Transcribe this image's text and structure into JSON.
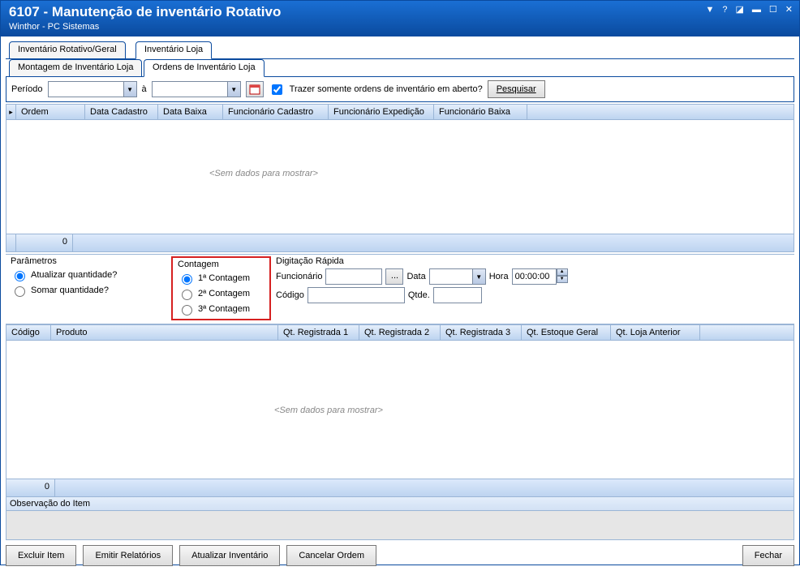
{
  "titlebar": {
    "title": "6107 - Manutenção de inventário Rotativo",
    "subtitle": "Winthor - PC Sistemas"
  },
  "tabs_main": {
    "tab0": "Inventário Rotativo/Geral",
    "tab1": "Inventário Loja"
  },
  "tabs_sub": {
    "tab0": "Montagem de Inventário Loja",
    "tab1": "Ordens de Inventário Loja"
  },
  "period": {
    "label": "Período",
    "to": "à",
    "chk_label": "Trazer somente ordens de inventário em aberto?",
    "search": "Pesquisar"
  },
  "grid1": {
    "cols": {
      "ordem": "Ordem",
      "data_cad": "Data Cadastro",
      "data_baixa": "Data Baixa",
      "func_cad": "Funcionário Cadastro",
      "func_exp": "Funcionário Expedição",
      "func_baixa": "Funcionário Baixa"
    },
    "empty": "<Sem dados para mostrar>",
    "foot0": "0"
  },
  "params": {
    "parametros": "Parâmetros",
    "atualizar": "Atualizar quantidade?",
    "somar": "Somar quantidade?",
    "contagem": "Contagem",
    "c1": "1ª Contagem",
    "c2": "2ª Contagem",
    "c3": "3ª Contagem",
    "digitacao": "Digitação Rápida",
    "funcionario": "Funcionário",
    "data": "Data",
    "hora": "Hora",
    "hora_val": "00:00:00",
    "codigo": "Código",
    "qtde": "Qtde."
  },
  "grid2": {
    "cols": {
      "codigo": "Código",
      "produto": "Produto",
      "qr1": "Qt. Registrada 1",
      "qr2": "Qt. Registrada 2",
      "qr3": "Qt. Registrada 3",
      "qeg": "Qt. Estoque Geral",
      "qla": "Qt. Loja Anterior"
    },
    "empty": "<Sem dados para mostrar>",
    "foot0": "0",
    "obs": "Observação do Item"
  },
  "buttons": {
    "excluir": "Excluir Item",
    "emitir": "Emitir Relatórios",
    "atualizar_inv": "Atualizar Inventário",
    "cancelar": "Cancelar Ordem",
    "fechar": "Fechar"
  }
}
